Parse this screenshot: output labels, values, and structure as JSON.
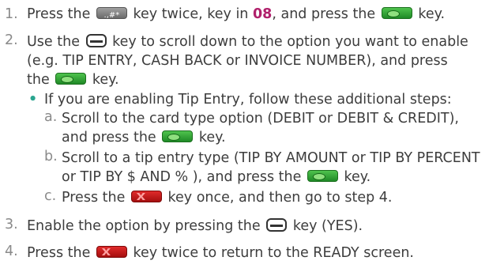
{
  "steps": {
    "s1": {
      "num": "1.",
      "a": "Press the",
      "b": "key twice, key in",
      "c": "08",
      "d": ", and press the",
      "e": "key."
    },
    "s2": {
      "num": "2.",
      "l1a": "Use the",
      "l1b": "key to scroll down to the option you want to enable",
      "l2": "(e.g. TIP ENTRY, CASH BACK or INVOICE NUMBER), and press",
      "l3a": "the",
      "l3b": "key."
    },
    "bullet": {
      "mark": "•",
      "text": "If you are enabling Tip Entry, follow these additional steps:"
    },
    "sa": {
      "num": "a.",
      "l1": "Scroll to the card type option (DEBIT or DEBIT & CREDIT),",
      "l2a": "and press the",
      "l2b": "key."
    },
    "sb": {
      "num": "b.",
      "l1": "Scroll to a tip entry type (TIP BY AMOUNT or TIP BY PERCENT",
      "l2a": "or TIP BY $ AND % ), and press the",
      "l2b": "key."
    },
    "sc": {
      "num": "c.",
      "a": "Press the",
      "b": "key once, and then go to step 4."
    },
    "s3": {
      "num": "3.",
      "a": "Enable the option by pressing the",
      "b": "key (YES)."
    },
    "s4": {
      "num": "4.",
      "a": "Press the",
      "b": "key twice to return to the READY screen."
    }
  }
}
